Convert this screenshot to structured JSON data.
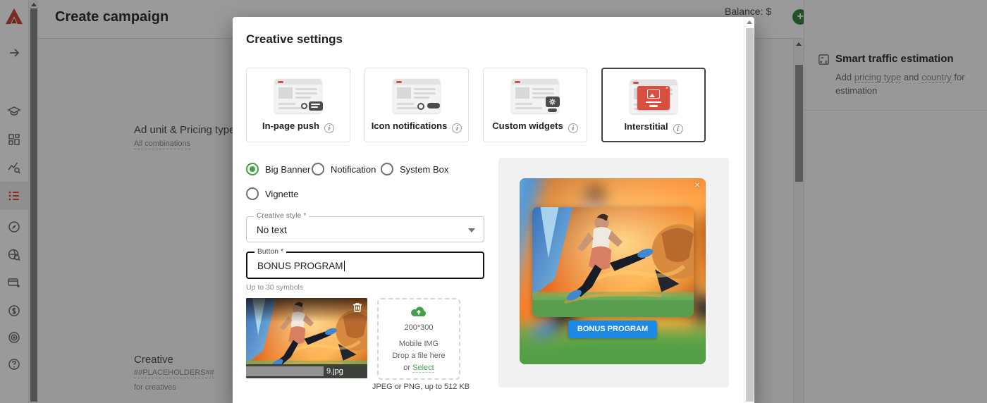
{
  "app": {
    "title": "Create campaign",
    "balance_label": "Balance: $"
  },
  "sidebar": {
    "items": [
      {
        "icon": "arrow-right-icon"
      },
      {
        "icon": "graduation-cap-icon"
      },
      {
        "icon": "dashboard-grid-icon"
      },
      {
        "icon": "statistics-search-icon"
      },
      {
        "icon": "campaign-list-icon",
        "active": true
      },
      {
        "icon": "compass-icon"
      },
      {
        "icon": "globe-search-icon"
      },
      {
        "icon": "card-plus-icon"
      },
      {
        "icon": "dollar-circle-icon"
      },
      {
        "icon": "target-icon"
      },
      {
        "icon": "help-icon"
      }
    ]
  },
  "content": {
    "ad_unit": {
      "title": "Ad unit & Pricing type",
      "link": "All combinations"
    },
    "creative": {
      "title": "Creative",
      "link": "##PLACEHOLDERS##",
      "note": "for creatives"
    }
  },
  "estimation": {
    "title": "Smart traffic estimation",
    "p1": "Add ",
    "link1": "pricing type",
    "p2": " and ",
    "link2": "country",
    "p3": " for estimation"
  },
  "modal": {
    "title": "Creative settings",
    "cards": [
      {
        "label": "In-page push",
        "selected": false
      },
      {
        "label": "Icon notifications",
        "selected": false
      },
      {
        "label": "Custom widgets",
        "selected": false
      },
      {
        "label": "Interstitial",
        "selected": true
      }
    ],
    "radios": [
      {
        "label": "Big Banner",
        "selected": true
      },
      {
        "label": "Notification",
        "selected": false
      },
      {
        "label": "System Box",
        "selected": false
      },
      {
        "label": "Vignette",
        "selected": false
      }
    ],
    "creative_style": {
      "label": "Creative style *",
      "value": "No text"
    },
    "button_field": {
      "label": "Button *",
      "value": "BONUS PROGRAM",
      "helper": "Up to 30 symbols"
    },
    "thumbnail": {
      "filename": "9.jpg"
    },
    "upload": {
      "size": "200*300",
      "line1": "Mobile IMG",
      "line2": "Drop a file here",
      "or_text": "or ",
      "select_label": "Select",
      "note": "JPEG or PNG, up to 512 KB"
    },
    "preview": {
      "button_label": "BONUS PROGRAM",
      "close_label": "×"
    }
  },
  "colors": {
    "brand_red": "#c0392b",
    "active_item_red": "#e03a2f",
    "accent_green": "#43a047",
    "accent_blue": "#1e88e5",
    "interstitial_red": "#d84f3f",
    "avatar_red": "#c63d20",
    "add_funds_green": "#2e7d32"
  }
}
